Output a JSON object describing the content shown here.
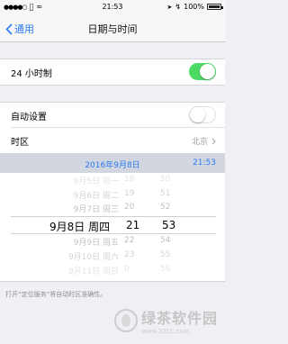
{
  "status_bar": {
    "carrier": "",
    "time": "21:53",
    "battery_percent": "100%"
  },
  "nav": {
    "back_label": "通用",
    "title": "日期与时间"
  },
  "settings": {
    "hour24_label": "24 小时制",
    "hour24_on": true,
    "auto_label": "自动设置",
    "auto_on": false,
    "timezone_label": "时区",
    "timezone_value": "北京"
  },
  "date_header": {
    "date": "2016年9月8日",
    "time": "21:53"
  },
  "picker": {
    "rows": [
      {
        "date": "9月5日 周一",
        "hour": "18",
        "min": "50"
      },
      {
        "date": "9月6日 周二",
        "hour": "19",
        "min": "51"
      },
      {
        "date": "9月7日 周三",
        "hour": "20",
        "min": "52"
      },
      {
        "date": "9月8日 周四",
        "hour": "21",
        "min": "53"
      },
      {
        "date": "9月9日 周五",
        "hour": "22",
        "min": "54"
      },
      {
        "date": "9月10日 周六",
        "hour": "23",
        "min": "55"
      },
      {
        "date": "9月11日 周日",
        "hour": "0",
        "min": "56"
      }
    ],
    "selected_index": 3
  },
  "footer_note": "打开“定位服务”将自动时区准确性。",
  "watermark": {
    "name": "绿茶软件园",
    "url": "www.33LC.com"
  }
}
